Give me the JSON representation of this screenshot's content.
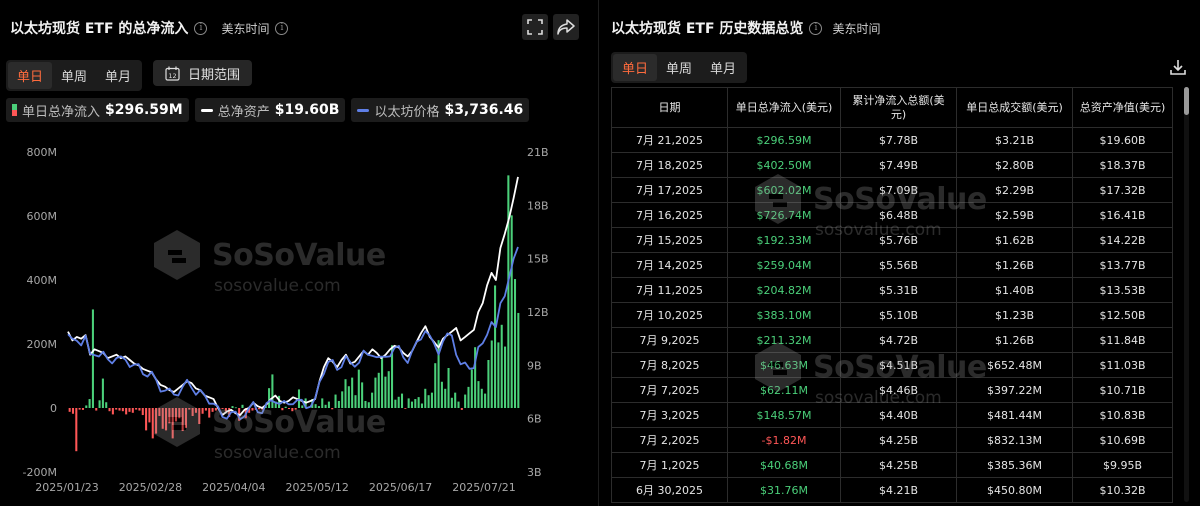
{
  "left": {
    "title": "以太坊现货 ETF 的总净流入",
    "timezone": "美东时间",
    "period_tabs": [
      "单日",
      "单周",
      "单月"
    ],
    "date_range_label": "日期范围",
    "date_range_icon_num": "12",
    "legend": {
      "inflow_label": "单日总净流入",
      "inflow_value": "$296.59M",
      "assets_label": "总净资产",
      "assets_value": "$19.60B",
      "price_label": "以太坊价格",
      "price_value": "$3,736.46"
    },
    "watermark": {
      "brand": "SoSoValue",
      "url": "sosovalue.com"
    }
  },
  "colors": {
    "positive": "#4bd07a",
    "negative": "#ff5757",
    "accent": "#ff6b3d",
    "price_line": "#5f7fe6",
    "assets_line": "#ffffff"
  },
  "chart_data": {
    "type": "bar",
    "x_ticks": [
      "2025/01/23",
      "2025/02/28",
      "2025/04/04",
      "2025/05/12",
      "2025/06/17",
      "2025/07/21"
    ],
    "y_left_ticks": [
      "800M",
      "600M",
      "400M",
      "200M",
      "0",
      "-200M"
    ],
    "y_left_range": [
      -200,
      800
    ],
    "y_right_ticks": [
      "21B",
      "18B",
      "15B",
      "12B",
      "9B",
      "6B",
      "3B"
    ],
    "y_right_range": [
      3,
      21
    ],
    "net_inflow_M": [
      -12,
      -18,
      -135,
      -5,
      -6,
      8,
      28,
      308,
      -8,
      24,
      92,
      18,
      -10,
      -20,
      -5,
      -8,
      -10,
      -20,
      -12,
      -15,
      -5,
      -8,
      -22,
      -70,
      -45,
      -95,
      -80,
      -25,
      -65,
      -70,
      -48,
      -95,
      -42,
      -32,
      -72,
      -62,
      -5,
      -25,
      -15,
      -50,
      -18,
      -8,
      -30,
      -12,
      -8,
      -5,
      -3,
      -10,
      -28,
      6,
      2,
      -40,
      10,
      -32,
      -15,
      -8,
      -6,
      -4,
      -5,
      6,
      62,
      105,
      20,
      38,
      -7,
      4,
      -3,
      -10,
      -5,
      58,
      8,
      30,
      4,
      28,
      12,
      6,
      30,
      10,
      20,
      -4,
      42,
      22,
      52,
      90,
      68,
      95,
      40,
      120,
      80,
      22,
      18,
      48,
      95,
      110,
      160,
      98,
      115,
      196,
      26,
      35,
      45,
      -2,
      30,
      20,
      28,
      34,
      14,
      60,
      40,
      48,
      140,
      212,
      82,
      60,
      125,
      32,
      48,
      20,
      -6,
      42,
      66,
      120,
      190,
      84,
      60,
      45,
      150,
      211,
      383,
      205,
      260,
      192,
      727,
      602,
      403,
      297
    ],
    "total_assets_B": [
      10.9,
      10.4,
      10.6,
      10.5,
      10.7,
      9.6,
      9.9,
      9.8,
      9.7,
      9.4,
      9.5,
      9.6,
      9.4,
      9.5,
      9.3,
      9.1,
      9.0,
      8.8,
      8.7,
      8.6,
      8.2,
      7.9,
      7.8,
      7.6,
      7.5,
      7.7,
      7.9,
      8.1,
      8.0,
      7.7,
      7.6,
      7.3,
      7.2,
      7.1,
      6.6,
      6.2,
      6.4,
      6.5,
      6.3,
      6.2,
      6.5,
      6.6,
      6.9,
      6.7,
      6.6,
      6.8,
      7.1,
      7.3,
      7.0,
      6.9,
      7.0,
      7.2,
      7.1,
      7.0,
      6.9,
      7.0,
      7.1,
      8.1,
      8.9,
      9.4,
      9.2,
      8.9,
      9.3,
      9.6,
      9.1,
      9.2,
      9.5,
      9.8,
      9.6,
      9.9,
      9.7,
      9.4,
      9.6,
      9.9,
      10.1,
      10.0,
      9.7,
      9.5,
      9.8,
      10.3,
      10.8,
      11.2,
      10.6,
      10.3,
      10.0,
      10.5,
      10.7,
      10.9,
      11.1,
      10.4,
      10.6,
      10.8,
      11.0,
      12.0,
      12.5,
      13.5,
      14.2,
      13.8,
      15.6,
      16.4,
      17.3,
      18.4,
      19.6
    ]
  },
  "right": {
    "title": "以太坊现货 ETF 历史数据总览",
    "timezone": "美东时间",
    "period_tabs": [
      "单日",
      "单周",
      "单月"
    ],
    "columns": [
      "日期",
      "单日总净流入(美元)",
      "累计净流入总额(美元)",
      "单日总成交额(美元)",
      "总资产净值(美元)"
    ],
    "rows": [
      [
        "7月 21,2025",
        "$296.59M",
        "$7.78B",
        "$3.21B",
        "$19.60B"
      ],
      [
        "7月 18,2025",
        "$402.50M",
        "$7.49B",
        "$2.80B",
        "$18.37B"
      ],
      [
        "7月 17,2025",
        "$602.02M",
        "$7.09B",
        "$2.29B",
        "$17.32B"
      ],
      [
        "7月 16,2025",
        "$726.74M",
        "$6.48B",
        "$2.59B",
        "$16.41B"
      ],
      [
        "7月 15,2025",
        "$192.33M",
        "$5.76B",
        "$1.62B",
        "$14.22B"
      ],
      [
        "7月 14,2025",
        "$259.04M",
        "$5.56B",
        "$1.26B",
        "$13.77B"
      ],
      [
        "7月 11,2025",
        "$204.82M",
        "$5.31B",
        "$1.40B",
        "$13.53B"
      ],
      [
        "7月 10,2025",
        "$383.10M",
        "$5.10B",
        "$1.23B",
        "$12.50B"
      ],
      [
        "7月 9,2025",
        "$211.32M",
        "$4.72B",
        "$1.26B",
        "$11.84B"
      ],
      [
        "7月 8,2025",
        "$46.63M",
        "$4.51B",
        "$652.48M",
        "$11.03B"
      ],
      [
        "7月 7,2025",
        "$62.11M",
        "$4.46B",
        "$397.22M",
        "$10.71B"
      ],
      [
        "7月 3,2025",
        "$148.57M",
        "$4.40B",
        "$481.44M",
        "$10.83B"
      ],
      [
        "7月 2,2025",
        "-$1.82M",
        "$4.25B",
        "$832.13M",
        "$10.69B"
      ],
      [
        "7月 1,2025",
        "$40.68M",
        "$4.25B",
        "$385.36M",
        "$9.95B"
      ],
      [
        "6月 30,2025",
        "$31.76M",
        "$4.21B",
        "$450.80M",
        "$10.32B"
      ]
    ],
    "watermark": {
      "brand": "SoSoValue",
      "url": "sosovalue.com"
    }
  }
}
